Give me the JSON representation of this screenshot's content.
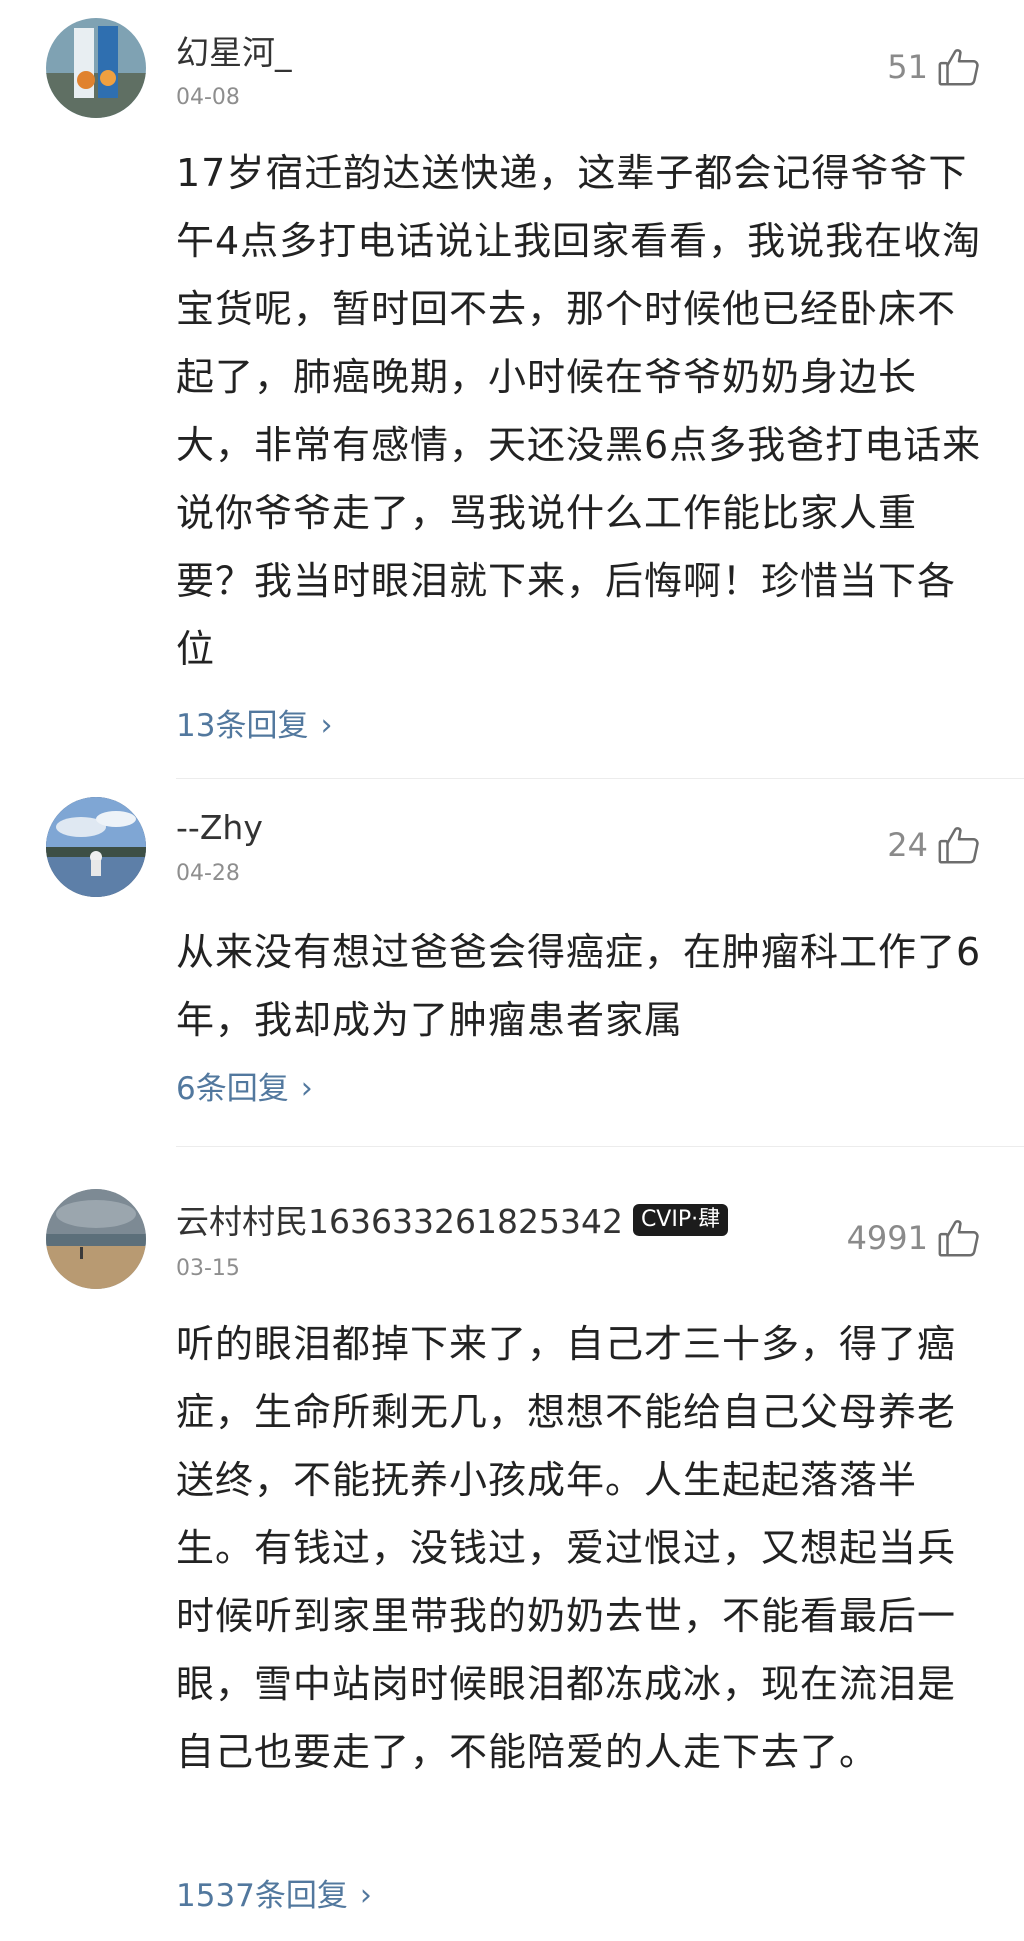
{
  "comments": [
    {
      "username": "幻星河_",
      "date": "04-08",
      "likes": "51",
      "text": "17岁宿迁韵达送快递，这辈子都会记得爷爷下午4点多打电话说让我回家看看，我说我在收淘宝货呢，暂时回不去，那个时候他已经卧床不起了，肺癌晚期，小时候在爷爷奶奶身边长大，非常有感情，天还没黑6点多我爸打电话来说你爷爷走了，骂我说什么工作能比家人重要？我当时眼泪就下来，后悔啊！珍惜当下各位",
      "replies": "13条回复"
    },
    {
      "username": "--Zhy",
      "date": "04-28",
      "likes": "24",
      "text": "从来没有想过爸爸会得癌症，在肿瘤科工作了6年，我却成为了肿瘤患者家属",
      "replies": "6条回复"
    },
    {
      "username": "云村村民163633261825342",
      "badge": "CVIP·肆",
      "date": "03-15",
      "likes": "4991",
      "text": "听的眼泪都掉下来了，自己才三十多，得了癌症，生命所剩无几，想想不能给自己父母养老送终，不能抚养小孩成年。人生起起落落半生。有钱过，没钱过，爱过恨过，又想起当兵时候听到家里带我的奶奶去世，不能看最后一眼，雪中站岗时候眼泪都冻成冰，现在流泪是自己也要走了，不能陪爱的人走下去了。",
      "replies": "1537条回复"
    }
  ],
  "icons": {
    "like": "thumbs-up-icon",
    "chevron": "chevron-right-icon"
  },
  "colors": {
    "reply_link": "#52789e",
    "meta": "#8e8e8e"
  }
}
